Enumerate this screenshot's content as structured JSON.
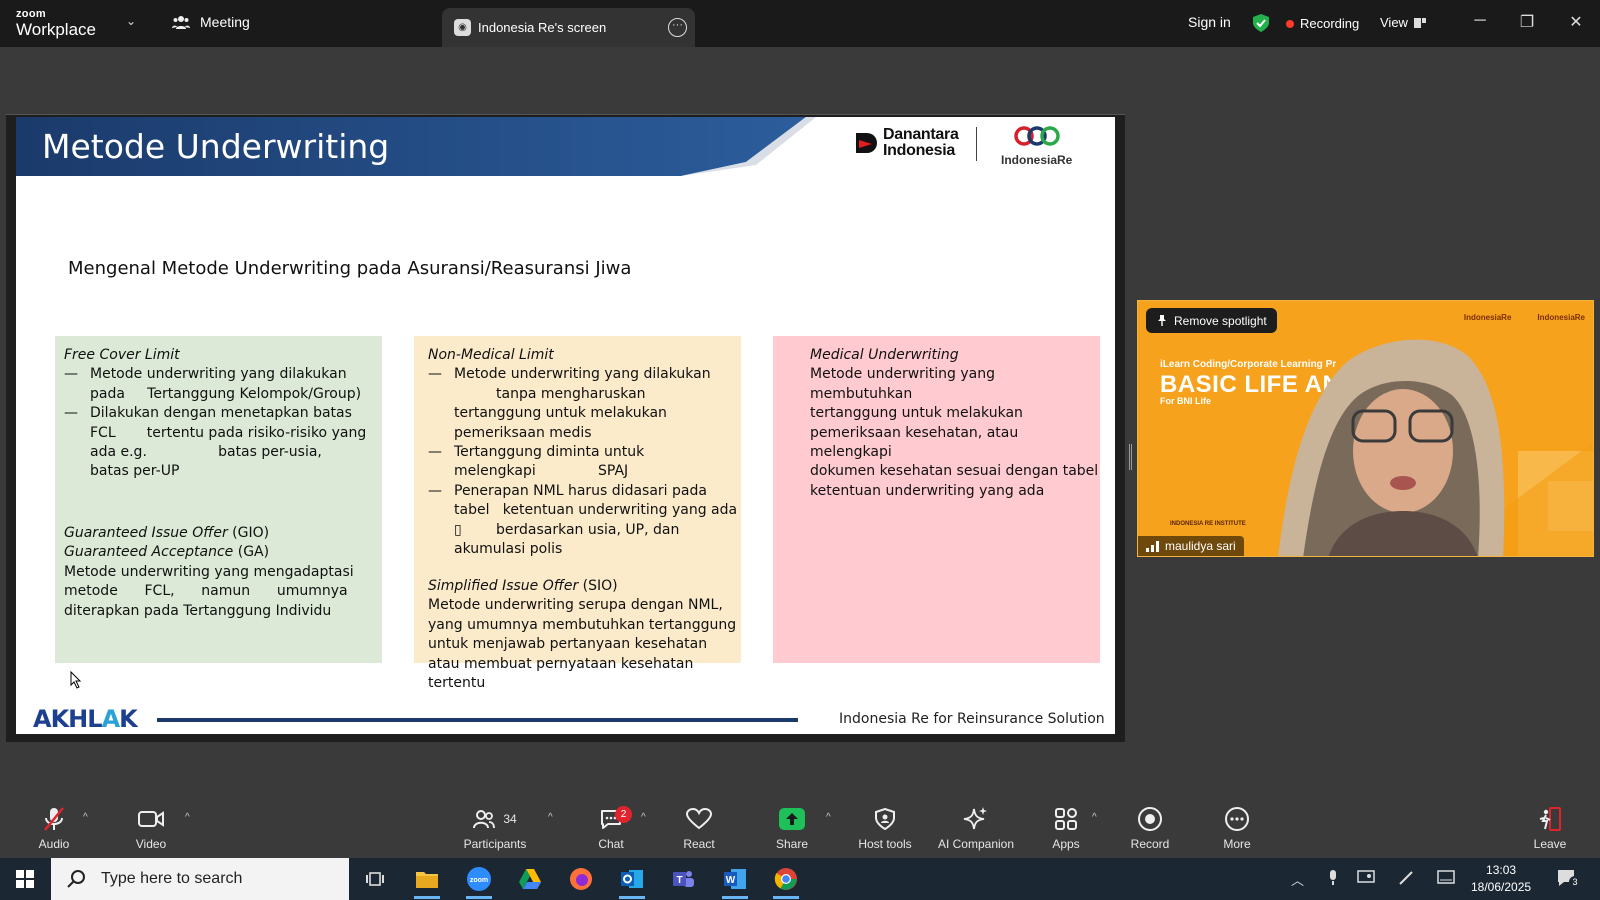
{
  "titlebar": {
    "logo_line1": "zoom",
    "logo_line2": "Workplace",
    "meeting_tab": "Meeting",
    "share_tab": "Indonesia Re's screen",
    "sign_in": "Sign in",
    "recording": "Recording",
    "view": "View"
  },
  "slide": {
    "title": "Metode Underwriting",
    "brand1": [
      "Danantara",
      "Indonesia"
    ],
    "brand2": "IndonesiaRe",
    "subtitle": "Mengenal Metode Underwriting pada Asuransi/Reasuransi Jiwa",
    "col1": {
      "heading": "Free Cover Limit",
      "bullet1_a": "Metode underwriting yang dilakukan",
      "bullet1_b": "pada     Tertanggung Kelompok/Group)",
      "bullet2_a": "Dilakukan dengan menetapkan batas",
      "bullet2_b": "FCL       tertentu pada risiko-risiko yang",
      "bullet2_c": "ada e.g.                batas per-usia,",
      "bullet2_d": "batas per-UP",
      "gio_heading": "Guaranteed Issue Offer",
      "gio_abbr": " (GIO)",
      "ga_heading": "Guaranteed Acceptance",
      "ga_abbr": " (GA)",
      "para1": "Metode underwriting yang mengadaptasi",
      "para2": "metode      FCL,      namun      umumnya",
      "para3": "diterapkan pada Tertanggung Individu"
    },
    "col2": {
      "heading": "Non-Medical Limit",
      "b1a": "Metode underwriting yang dilakukan",
      "b1b": "tanpa mengharuskan",
      "b1c": "tertanggung untuk melakukan",
      "b1d": "pemeriksaan medis",
      "b2a": "Tertanggung diminta untuk",
      "b2b": "melengkapi              SPAJ",
      "b3a": "Penerapan NML harus didasari pada",
      "b3b": "tabel   ketentuan underwriting yang ada",
      "b3c_glyph": "▯",
      "b3c": "berdasarkan usia, UP, dan",
      "b3d": "akumulasi polis",
      "sio_heading": "Simplified Issue Offer",
      "sio_abbr": " (SIO)",
      "s1": "Metode underwriting serupa dengan NML,",
      "s2": "yang umumnya membutuhkan tertanggung",
      "s3": "untuk menjawab pertanyaan kesehatan",
      "s4": "atau membuat pernyataan kesehatan",
      "s5": "tertentu"
    },
    "col3": {
      "heading": "Medical Underwriting",
      "l1": "Metode underwriting yang membutuhkan",
      "l2": "tertanggung untuk melakukan",
      "l3": "pemeriksaan kesehatan, atau melengkapi",
      "l4": "dokumen kesehatan sesuai dengan tabel",
      "l5": "ketentuan underwriting yang ada"
    },
    "footer_logo_a": "AKHL",
    "footer_logo_b": "A",
    "footer_logo_c": "K",
    "tagline": "Indonesia Re for Reinsurance Solution"
  },
  "video": {
    "spotlight": "Remove spotlight",
    "name": "maulidya sari",
    "banner_small": "iLearn Coding/Corporate Learning Pr",
    "banner_title": "BASIC LIFE AND HE          NING",
    "banner_sub": "For BNI Life",
    "brand_left": "IndonesiaRe",
    "brand_right": "IndonesiaRe",
    "institute": "INDONESIA RE INSTITUTE"
  },
  "toolbar": {
    "audio": "Audio",
    "video": "Video",
    "participants": "Participants",
    "participants_count": "34",
    "chat": "Chat",
    "chat_badge": "2",
    "react": "React",
    "share": "Share",
    "host_tools": "Host tools",
    "ai_companion": "AI Companion",
    "apps": "Apps",
    "record": "Record",
    "more": "More",
    "leave": "Leave"
  },
  "taskbar": {
    "search_placeholder": "Type here to search",
    "time": "13:03",
    "date": "18/06/2025",
    "notif_count": "3"
  },
  "colors": {
    "slide_header_blue": "#1b3a6b",
    "col1_bg": "#dbe9d6",
    "col2_bg": "#fcebcb",
    "col3_bg": "#ffcbd0",
    "video_orange": "#f7a21c",
    "recording_red": "#ff3b30",
    "share_green": "#1fbf5a",
    "chat_badge_red": "#e0242e"
  }
}
